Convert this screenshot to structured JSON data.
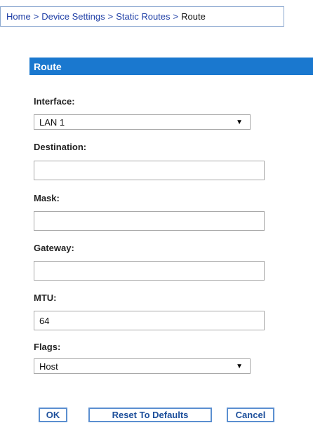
{
  "breadcrumb": {
    "items": [
      "Home",
      "Device Settings",
      "Static Routes"
    ],
    "separator": ">",
    "current": "Route"
  },
  "section": {
    "title": "Route"
  },
  "form": {
    "interface": {
      "label": "Interface:",
      "value": "LAN 1"
    },
    "destination": {
      "label": "Destination:",
      "value": "",
      "placeholder": ""
    },
    "mask": {
      "label": "Mask:",
      "value": "",
      "placeholder": ""
    },
    "gateway": {
      "label": "Gateway:",
      "value": "",
      "placeholder": ""
    },
    "mtu": {
      "label": "MTU:",
      "value": "64",
      "placeholder": ""
    },
    "flags": {
      "label": "Flags:",
      "value": "Host"
    }
  },
  "buttons": {
    "ok": "OK",
    "reset": "Reset To Defaults",
    "cancel": "Cancel"
  },
  "icons": {
    "dropdown": "chevron-down-icon"
  },
  "colors": {
    "header_bg": "#1a78cf",
    "link": "#1f3fa6",
    "button_border": "#5b8fd0",
    "button_text": "#1d4f9b"
  }
}
